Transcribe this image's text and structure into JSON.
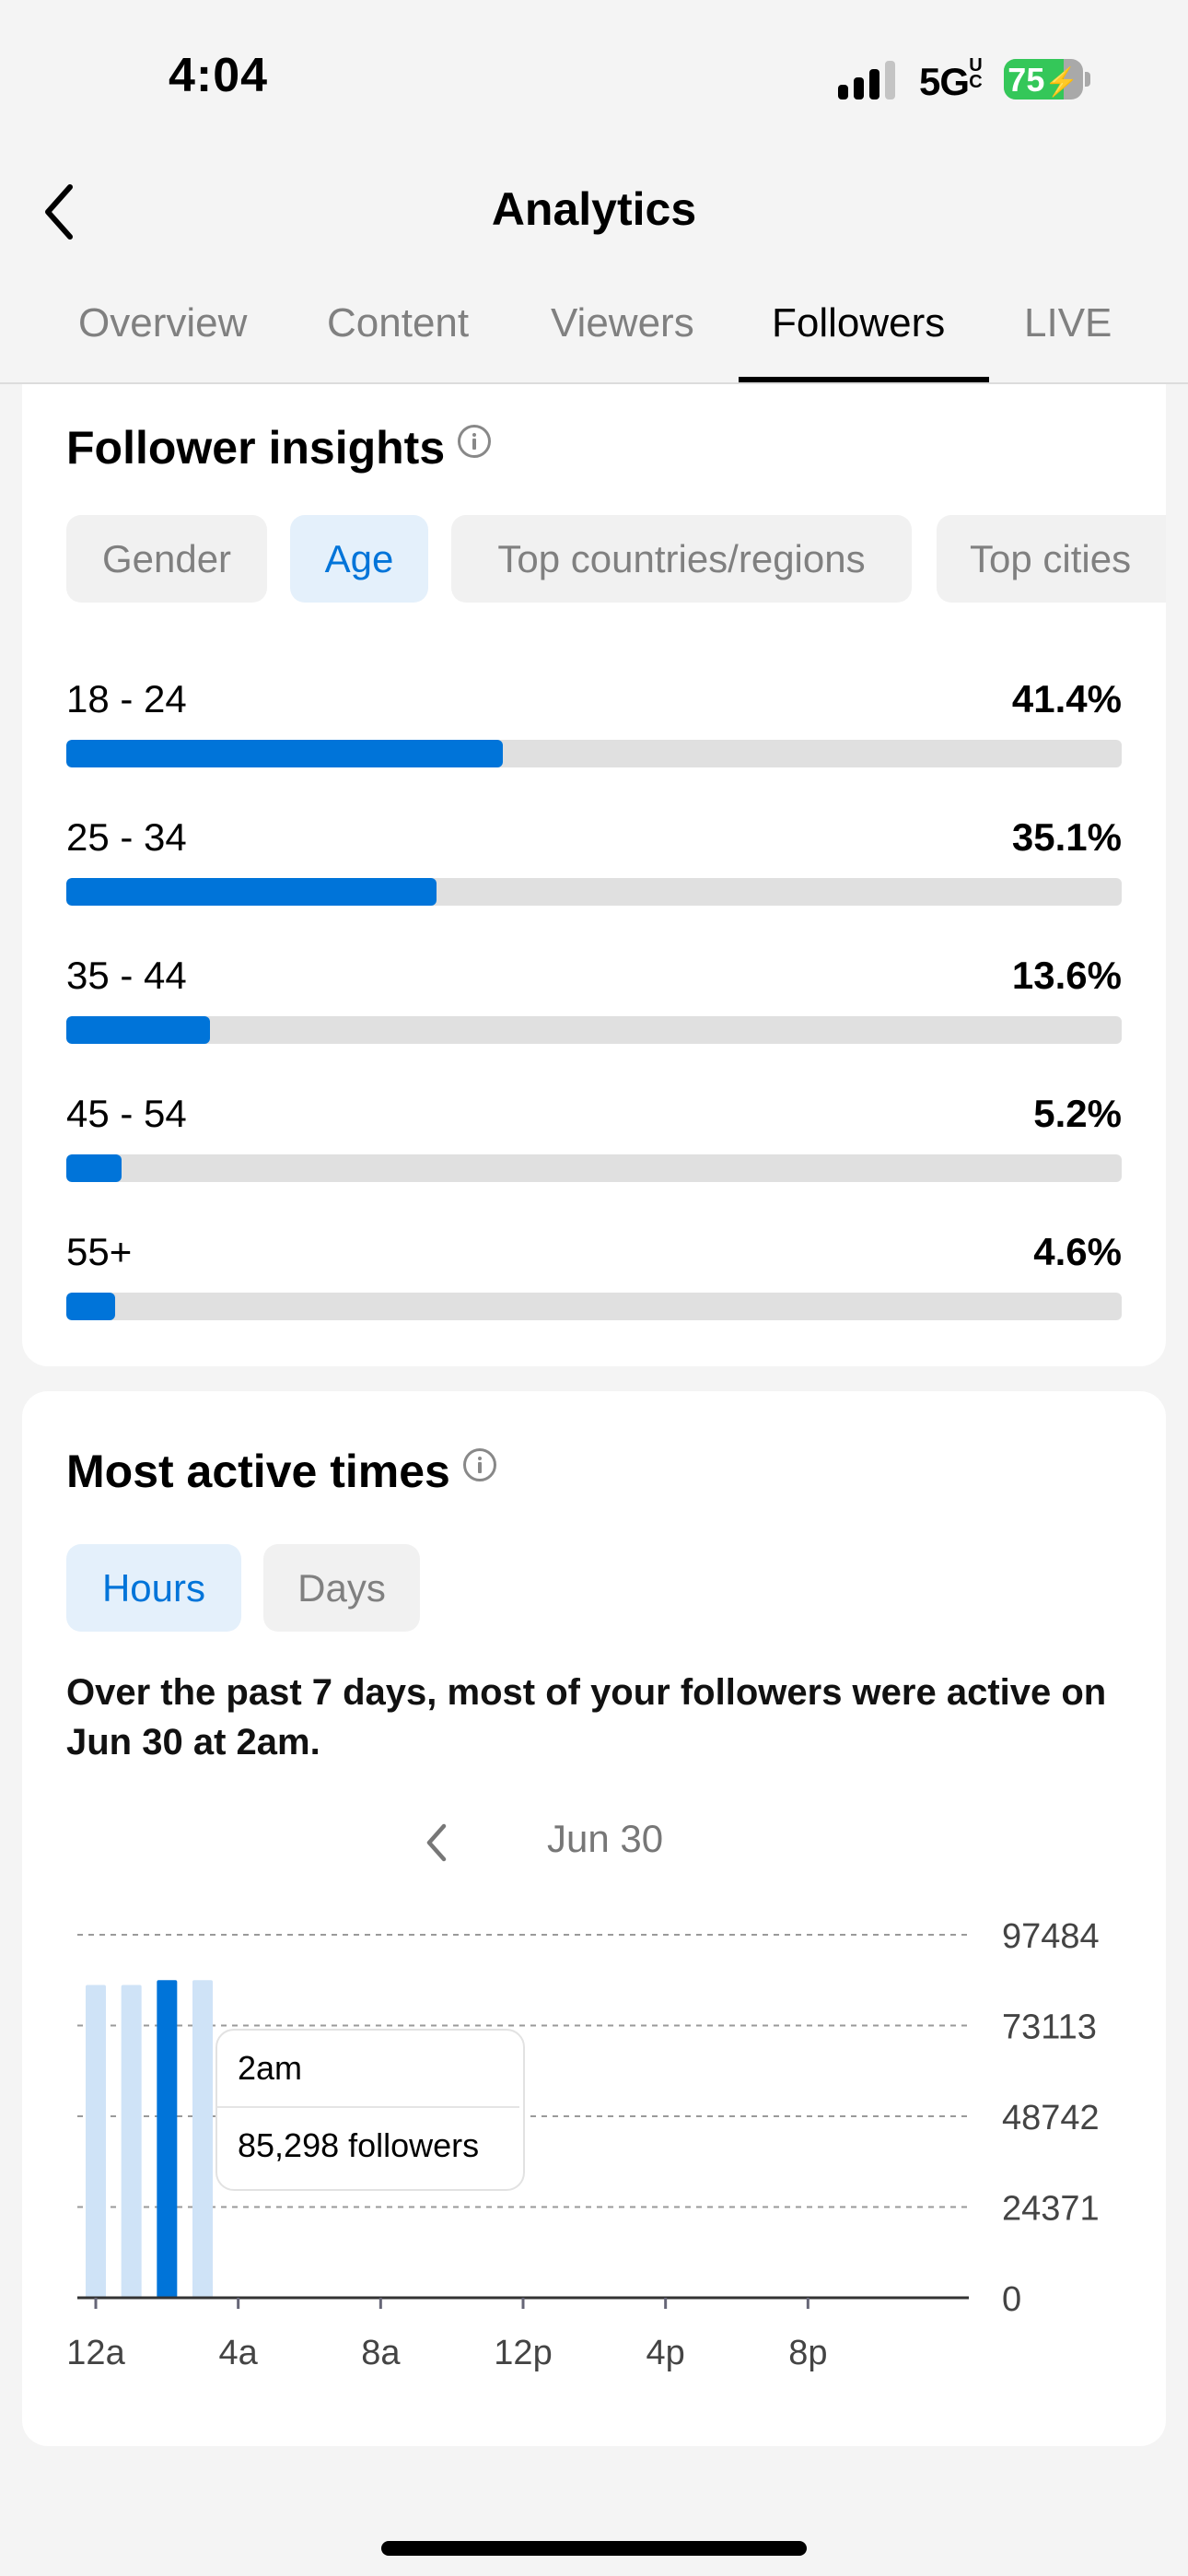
{
  "status_bar": {
    "time": "4:04",
    "network": "5G",
    "network_suffix_top": "U",
    "network_suffix_bottom": "C",
    "battery": "75",
    "battery_charging": true,
    "signal_bars_active": 3,
    "signal_bars_total": 4
  },
  "nav": {
    "back_icon": "chevron-left-icon",
    "title": "Analytics"
  },
  "tabs": [
    {
      "label": "Overview",
      "active": false
    },
    {
      "label": "Content",
      "active": false
    },
    {
      "label": "Viewers",
      "active": false
    },
    {
      "label": "Followers",
      "active": true
    },
    {
      "label": "LIVE",
      "active": false
    }
  ],
  "follower_insights": {
    "title": "Follower insights",
    "info_icon": "info-icon",
    "filters": [
      {
        "label": "Gender",
        "active": false
      },
      {
        "label": "Age",
        "active": true
      },
      {
        "label": "Top countries/regions",
        "active": false
      },
      {
        "label": "Top cities",
        "active": false
      }
    ],
    "age_groups": [
      {
        "label": "18 - 24",
        "value": "41.4%",
        "percent": 41.4
      },
      {
        "label": "25 - 34",
        "value": "35.1%",
        "percent": 35.1
      },
      {
        "label": "35 - 44",
        "value": "13.6%",
        "percent": 13.6
      },
      {
        "label": "45 - 54",
        "value": "5.2%",
        "percent": 5.2
      },
      {
        "label": "55+",
        "value": "4.6%",
        "percent": 4.6
      }
    ]
  },
  "most_active": {
    "title": "Most active times",
    "info_icon": "info-icon",
    "toggle": [
      {
        "label": "Hours",
        "active": true
      },
      {
        "label": "Days",
        "active": false
      }
    ],
    "description": "Over the past 7 days, most of your followers were active on Jun 30 at 2am.",
    "date_label": "Jun 30",
    "prev_icon": "chevron-left-icon",
    "tooltip": {
      "time": "2am",
      "value": "85,298 followers"
    }
  },
  "chart_data": {
    "type": "bar",
    "title": "",
    "xlabel": "",
    "ylabel": "",
    "x": [
      "12a",
      "1a",
      "2a",
      "3a"
    ],
    "values": [
      84000,
      84000,
      85298,
      85300
    ],
    "highlight_index": 2,
    "x_range_hours": [
      0,
      24
    ],
    "x_ticks": [
      "12a",
      "4a",
      "8a",
      "12p",
      "4p",
      "8p"
    ],
    "y_ticks": [
      0,
      24371,
      48742,
      73113,
      97484
    ],
    "ylim": [
      0,
      97484
    ],
    "grid": true,
    "y_axis_position": "right",
    "colors": {
      "highlight": "#0074d9",
      "normal": "#cfe3f7"
    }
  },
  "colors": {
    "accent": "#0074d9",
    "chip_active_bg": "#e4f0fb",
    "chip_bg": "#f1f1f1",
    "track": "#e0e0e0",
    "battery_green": "#34c759"
  }
}
